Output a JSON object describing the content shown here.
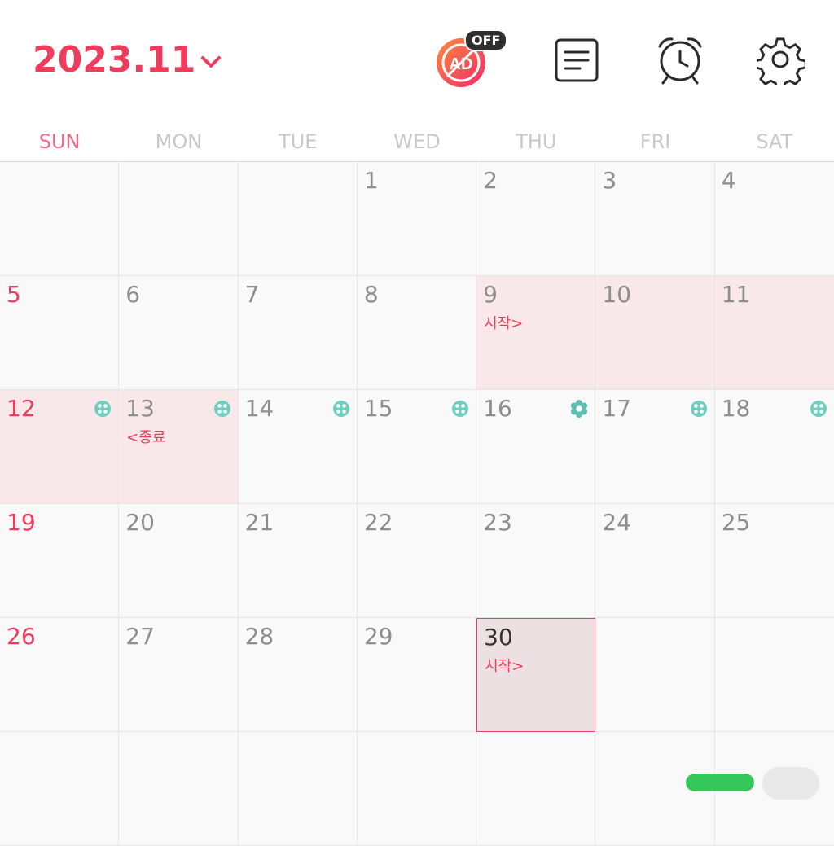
{
  "header": {
    "month_label": "2023.11",
    "ad_badge": "OFF",
    "ad_label": "AD"
  },
  "weekdays": [
    "SUN",
    "MON",
    "TUE",
    "WED",
    "THU",
    "FRI",
    "SAT"
  ],
  "colors": {
    "accent": "#ef3b5c",
    "period_bg": "#f9e8ea",
    "fertile_icon": "#6ccfc0"
  },
  "calendar": {
    "cells": [
      {
        "day": ""
      },
      {
        "day": ""
      },
      {
        "day": ""
      },
      {
        "day": "1"
      },
      {
        "day": "2"
      },
      {
        "day": "3"
      },
      {
        "day": "4"
      },
      {
        "day": "5",
        "sun": true
      },
      {
        "day": "6"
      },
      {
        "day": "7"
      },
      {
        "day": "8"
      },
      {
        "day": "9",
        "period": true,
        "note": "시작>"
      },
      {
        "day": "10",
        "period": true
      },
      {
        "day": "11",
        "period": true
      },
      {
        "day": "12",
        "sun": true,
        "period": true,
        "icon": "fertile-icon"
      },
      {
        "day": "13",
        "period": true,
        "note": "<종료",
        "icon": "fertile-icon"
      },
      {
        "day": "14",
        "icon": "fertile-icon"
      },
      {
        "day": "15",
        "icon": "fertile-icon"
      },
      {
        "day": "16",
        "icon": "ovulation-icon"
      },
      {
        "day": "17",
        "icon": "fertile-icon"
      },
      {
        "day": "18",
        "icon": "fertile-icon"
      },
      {
        "day": "19",
        "sun": true
      },
      {
        "day": "20"
      },
      {
        "day": "21"
      },
      {
        "day": "22"
      },
      {
        "day": "23"
      },
      {
        "day": "24"
      },
      {
        "day": "25"
      },
      {
        "day": "26",
        "sun": true
      },
      {
        "day": "27"
      },
      {
        "day": "28"
      },
      {
        "day": "29"
      },
      {
        "day": "30",
        "today": true,
        "note": "시작>"
      },
      {
        "day": ""
      },
      {
        "day": ""
      },
      {
        "day": ""
      },
      {
        "day": ""
      },
      {
        "day": ""
      },
      {
        "day": ""
      },
      {
        "day": ""
      },
      {
        "day": ""
      },
      {
        "day": ""
      }
    ]
  }
}
